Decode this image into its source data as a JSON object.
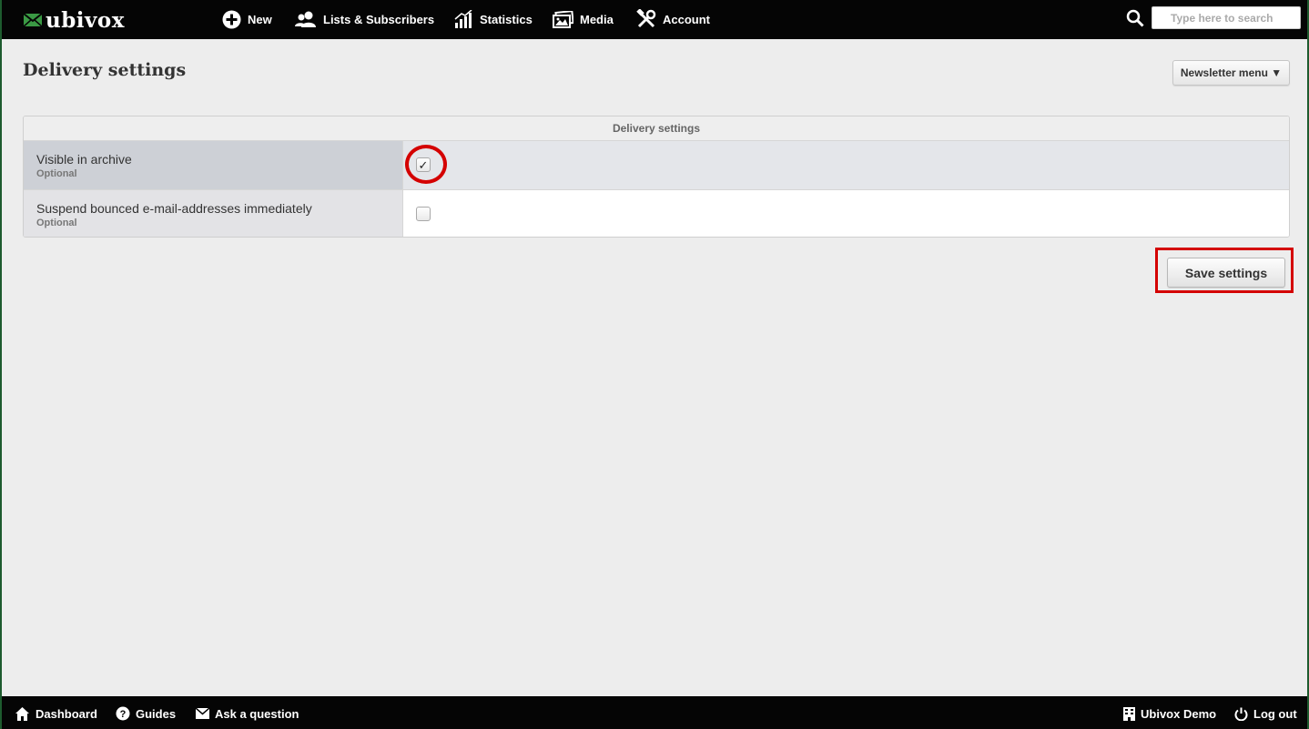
{
  "brand": {
    "name": "ubivox",
    "accent": "#3a9a44"
  },
  "nav": [
    {
      "label": "New",
      "icon": "plus-circle-icon"
    },
    {
      "label": "Lists & Subscribers",
      "icon": "users-icon"
    },
    {
      "label": "Statistics",
      "icon": "statistics-icon"
    },
    {
      "label": "Media",
      "icon": "media-icon"
    },
    {
      "label": "Account",
      "icon": "tools-icon"
    }
  ],
  "search": {
    "placeholder": "Type here to search",
    "icon": "search-icon"
  },
  "page": {
    "title": "Delivery settings",
    "newsletter_menu_label": "Newsletter menu ▼"
  },
  "panel": {
    "header": "Delivery settings",
    "rows": [
      {
        "label": "Visible in archive",
        "hint": "Optional",
        "checked": true,
        "check_mark": "✓"
      },
      {
        "label": "Suspend bounced e-mail-addresses immediately",
        "hint": "Optional",
        "checked": false,
        "check_mark": ""
      }
    ]
  },
  "save_label": "Save settings",
  "annotation_color": "#d40000",
  "footer": {
    "left": [
      {
        "label": "Dashboard",
        "icon": "home-icon"
      },
      {
        "label": "Guides",
        "icon": "question-icon"
      },
      {
        "label": "Ask a question",
        "icon": "envelope-icon"
      }
    ],
    "right": [
      {
        "label": "Ubivox Demo",
        "icon": "building-icon"
      },
      {
        "label": "Log out",
        "icon": "power-icon"
      }
    ]
  }
}
